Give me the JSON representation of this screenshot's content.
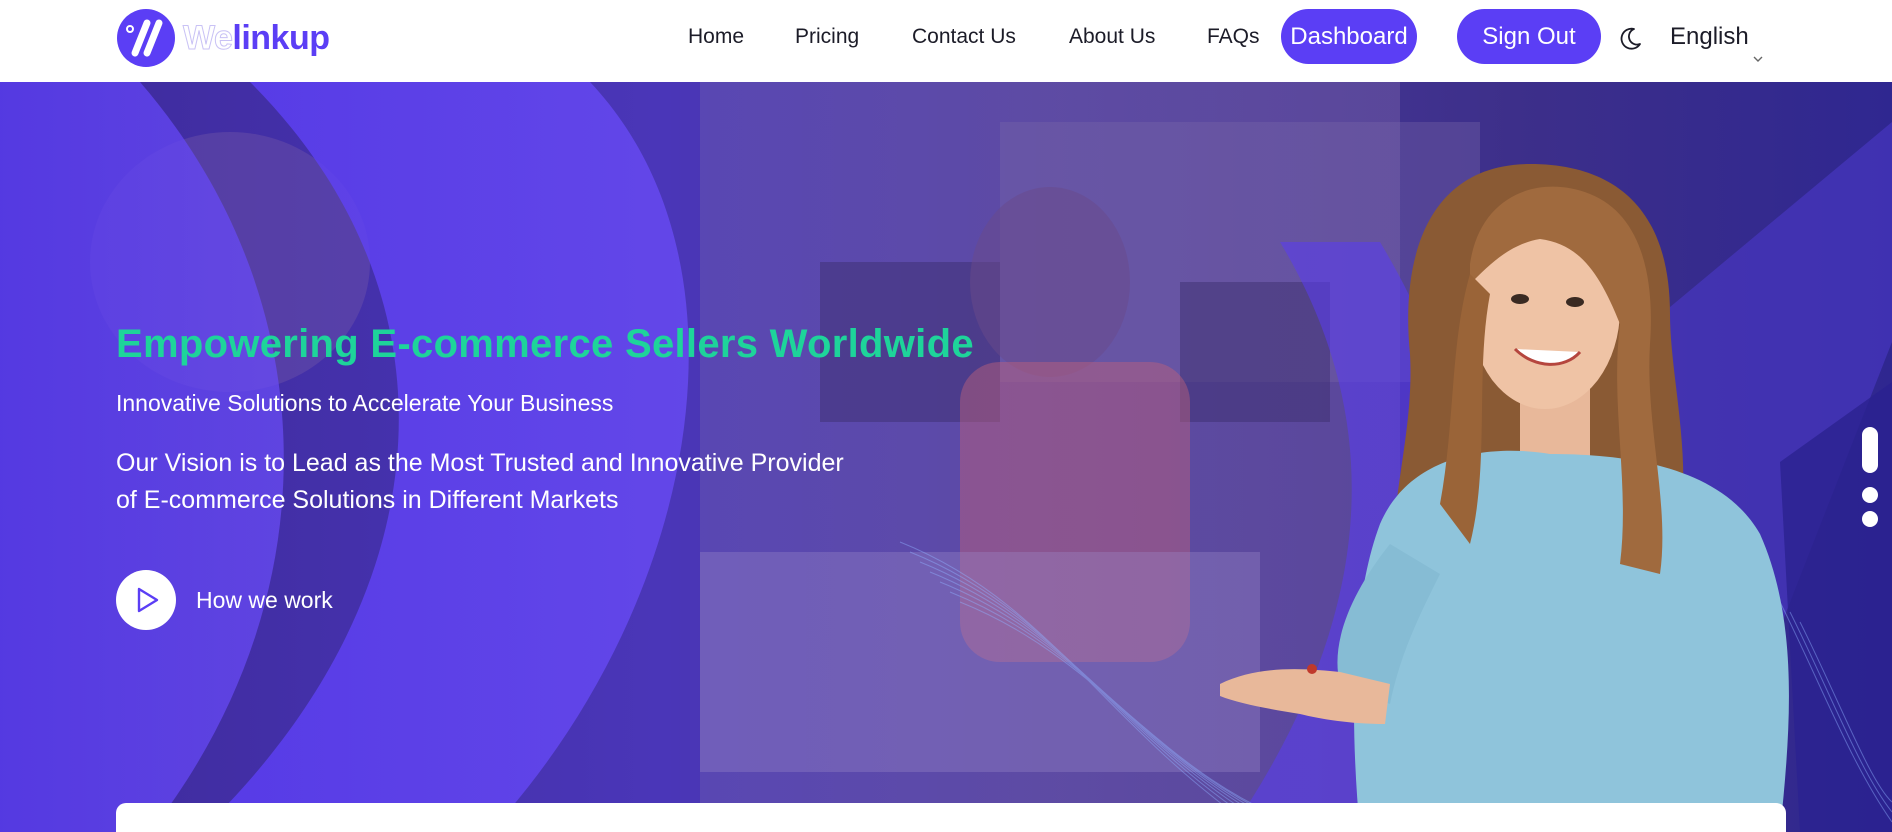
{
  "brand": {
    "name_part1": "We",
    "name_part2": "linkup",
    "accent_color": "#5b3ef5"
  },
  "nav": {
    "links": [
      "Home",
      "Pricing",
      "Contact Us",
      "About Us",
      "FAQs"
    ],
    "dashboard_label": "Dashboard",
    "signout_label": "Sign Out",
    "theme_icon": "moon-icon",
    "language": "English"
  },
  "hero": {
    "title": "Empowering E-commerce Sellers Worldwide",
    "subtitle": "Innovative Solutions to Accelerate Your Business",
    "vision_line1": "Our Vision is to Lead as the Most Trusted and Innovative Provider",
    "vision_line2": "of E-commerce Solutions in Different Markets",
    "cta_label": "How we work",
    "title_color": "#1ed49a"
  },
  "slider": {
    "slides": 3,
    "active_index": 0
  }
}
